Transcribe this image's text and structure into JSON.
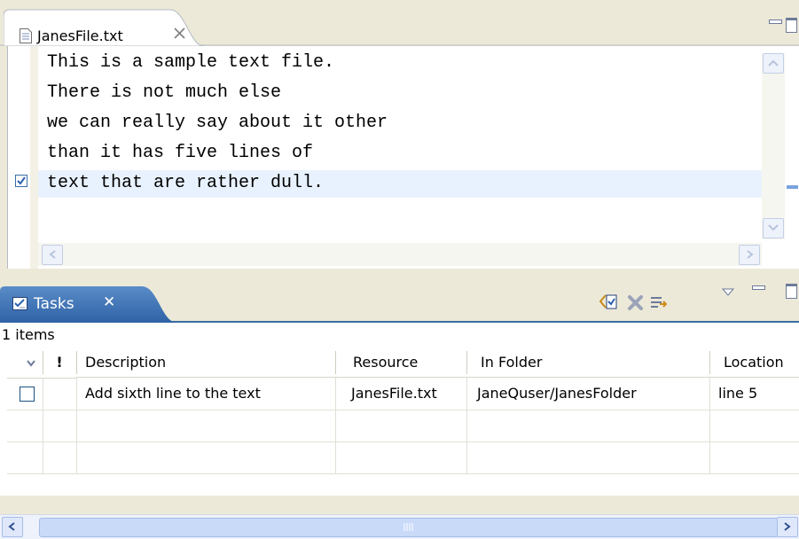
{
  "editor": {
    "tab_title": "JanesFile.txt",
    "tab_close_icon": "close-x-icon",
    "file_icon": "text-file-icon",
    "lines": [
      "This is a sample text file.",
      "There is not much else",
      "we can really say about it other",
      "than it has five lines of",
      "text that are rather dull."
    ],
    "current_line_index": 4,
    "task_marker_icon": "task-checkbox-icon"
  },
  "tasks": {
    "tab_label": "Tasks",
    "tab_close": "✕",
    "items_count": "1 items",
    "toolbar": [
      "add-task-icon",
      "delete-icon",
      "filter-icon",
      "view-menu-icon",
      "minimize-icon",
      "maximize-icon"
    ],
    "columns": [
      "",
      "!",
      "Description",
      "Resource",
      "In Folder",
      "Location"
    ],
    "rows": [
      {
        "description": "Add sixth line to the text",
        "resource": "JanesFile.txt",
        "folder": "JaneQuser/JanesFolder",
        "location": "line 5"
      }
    ]
  },
  "colors": {
    "accent": "#3A6EA5",
    "current_line": "#E8F2FE",
    "background": "#ECE9D8"
  }
}
